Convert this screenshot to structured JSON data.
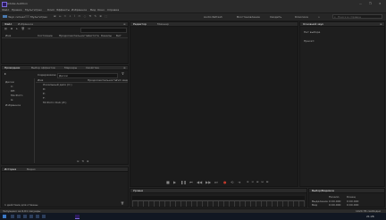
{
  "window": {
    "title": "Adobe Audition",
    "controls": [
      "—",
      "❐",
      "✕"
    ]
  },
  "menu": {
    "items": [
      "Файл",
      "Правка",
      "Мультитрек",
      "Клип",
      "Эффекты",
      "Избранное",
      "Вид",
      "Окно",
      "Справка"
    ]
  },
  "toolbar": {
    "mode_waveform": "Звук сигнала",
    "mode_multitrack": "Мультитрек",
    "workspaces": [
      "Audio Refresh",
      "Восстановление",
      "Сводить",
      "Классика"
    ],
    "search_placeholder": "Поиск в справке"
  },
  "files_panel": {
    "tab": "Файл",
    "tab2": "Избранное",
    "columns": [
      "Имя",
      "Состояние",
      "Продолжительность",
      "Частота",
      "Каналы",
      "Бит"
    ]
  },
  "media_panel": {
    "tabs": [
      "Проводник",
      "Выбор эффектов",
      "Маркеры",
      "Свойства"
    ],
    "location_label": "Содержимое:",
    "location_value": "Диски",
    "columns": [
      "Имя",
      "Продолжительность",
      "Тип мед"
    ],
    "tree": [
      "Диски",
      "C:",
      "DE:",
      "Ми Фото",
      "G:",
      "Избранное"
    ],
    "list": [
      "Локальный диск (C:)",
      "D:",
      "E:",
      "F:",
      "Mi Фото Club (Z:)"
    ]
  },
  "history_panel": {
    "tabs": [
      "История",
      "Видео"
    ],
    "status": "1 действие для отмены"
  },
  "editor": {
    "tabs": [
      "Редактор",
      "Микшер"
    ]
  },
  "essential_sound": {
    "tab": "Основной звук",
    "label1": "Нет выбора",
    "label2": "Пресет:"
  },
  "timeline": {
    "tab": "Уровни"
  },
  "selection_panel": {
    "tab": "Выбор/Видимое",
    "cols": [
      "Начало",
      "Конец"
    ],
    "rows": [
      {
        "label": "Выделение",
        "start": "0:00.000",
        "end": "0:00.000"
      },
      {
        "label": "Вид",
        "start": "0:00.000",
        "end": "0:00.000"
      }
    ]
  },
  "status_bar": {
    "left": "Запущено за 6,61 секунды",
    "right": "1024 ГБ свободно"
  },
  "taskbar": {
    "time": "21:26"
  }
}
